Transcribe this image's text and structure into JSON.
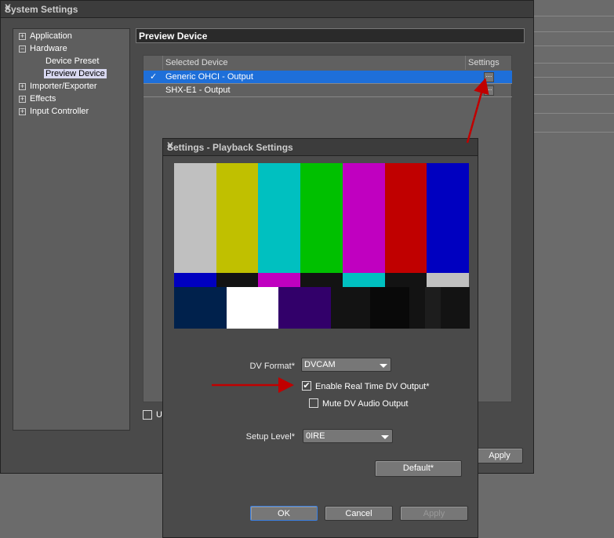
{
  "main_window": {
    "title": "System Settings",
    "close": "X"
  },
  "tree": [
    {
      "label": "Application",
      "expander": "+"
    },
    {
      "label": "Hardware",
      "expander": "−"
    },
    {
      "label": "Device Preset"
    },
    {
      "label": "Preview Device"
    },
    {
      "label": "Importer/Exporter",
      "expander": "+"
    },
    {
      "label": "Effects",
      "expander": "+"
    },
    {
      "label": "Input Controller",
      "expander": "+"
    }
  ],
  "panel": {
    "header": "Preview Device",
    "columns": [
      "Selected Device",
      "Settings"
    ],
    "rows": [
      {
        "check": "✓",
        "name": "Generic OHCI - Output"
      },
      {
        "check": "",
        "name": "SHX-E1 - Output"
      }
    ],
    "settings_glyph": "⋯",
    "partial_checkbox_label": "Us",
    "apply": "Apply"
  },
  "dialog": {
    "title": "Settings - Playback Settings",
    "close": "X",
    "dv_format_label": "DV Format*",
    "dv_format_value": "DVCAM",
    "enable_rt": "Enable Real Time DV Output*",
    "enable_rt_checked": true,
    "check": "✔",
    "mute": "Mute DV Audio Output",
    "mute_checked": false,
    "setup_level_label": "Setup Level*",
    "setup_level_value": "0IRE",
    "default": "Default*",
    "ok": "OK",
    "cancel": "Cancel",
    "apply": "Apply"
  },
  "colors": {
    "annotation_arrow": "#c00000",
    "selection": "#1e6fd9"
  },
  "color_bars": {
    "top": [
      "#c0c0c0",
      "#c0c000",
      "#00c0c0",
      "#00c000",
      "#c000c0",
      "#c00000",
      "#0000c0"
    ],
    "middle": [
      "#0000c0",
      "#131313",
      "#c000c0",
      "#131313",
      "#00c0c0",
      "#131313",
      "#c0c0c0"
    ],
    "bottom": [
      "#00214c",
      "#ffffff",
      "#32006a",
      "#131313",
      "#090909",
      "#131313",
      "#1d1d1d",
      "#131313"
    ]
  }
}
